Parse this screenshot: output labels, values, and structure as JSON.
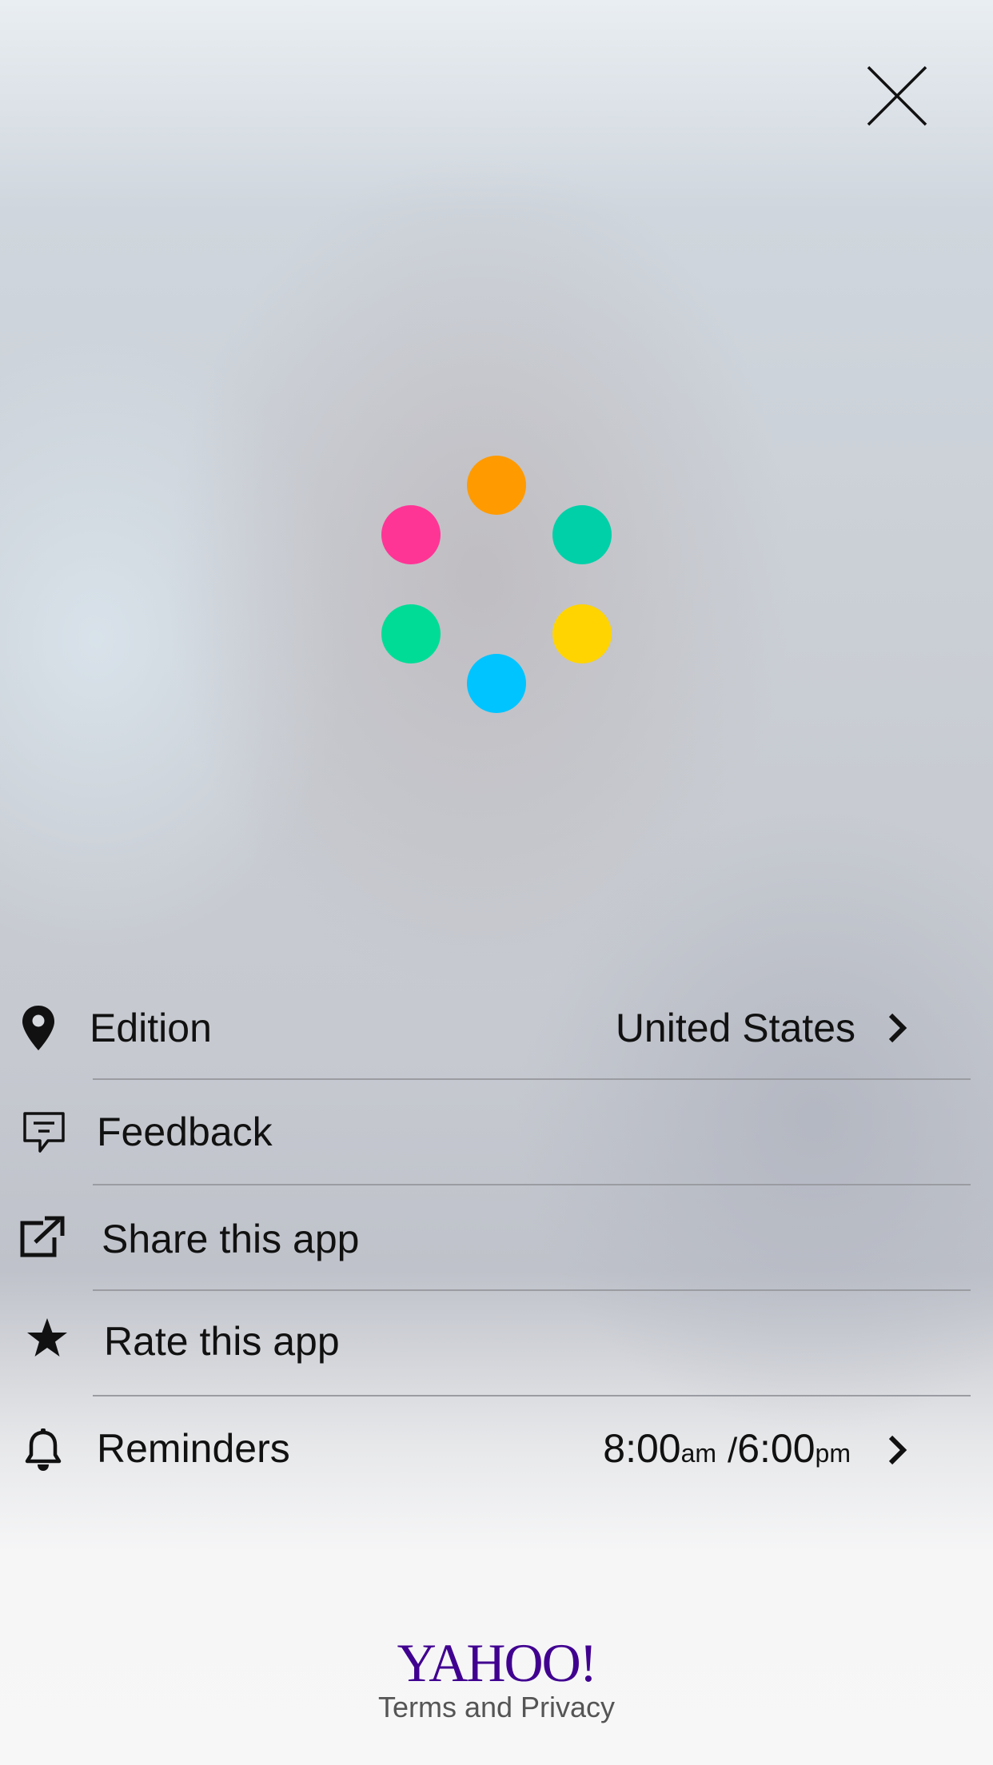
{
  "close": {
    "icon": "close-icon"
  },
  "loader": {
    "icon": "loading-spinner-icon",
    "dot_colors": [
      "#ff9a00",
      "#00d0a8",
      "#ffd400",
      "#00c4ff",
      "#00dc96",
      "#ff3596"
    ]
  },
  "menu": {
    "edition": {
      "icon": "location-pin-icon",
      "label": "Edition",
      "value": "United States"
    },
    "feedback": {
      "icon": "feedback-chat-icon",
      "label": "Feedback"
    },
    "share": {
      "icon": "share-external-icon",
      "label": "Share this app"
    },
    "rate": {
      "icon": "star-icon",
      "label": "Rate this app"
    },
    "reminders": {
      "icon": "bell-icon",
      "label": "Reminders",
      "morning_time": "8:00",
      "morning_suffix": "am",
      "separator": "/",
      "evening_time": "6:00",
      "evening_suffix": "pm"
    }
  },
  "footer": {
    "logo": "YAHOO!",
    "link": "Terms and Privacy",
    "logo_color": "#400090"
  }
}
